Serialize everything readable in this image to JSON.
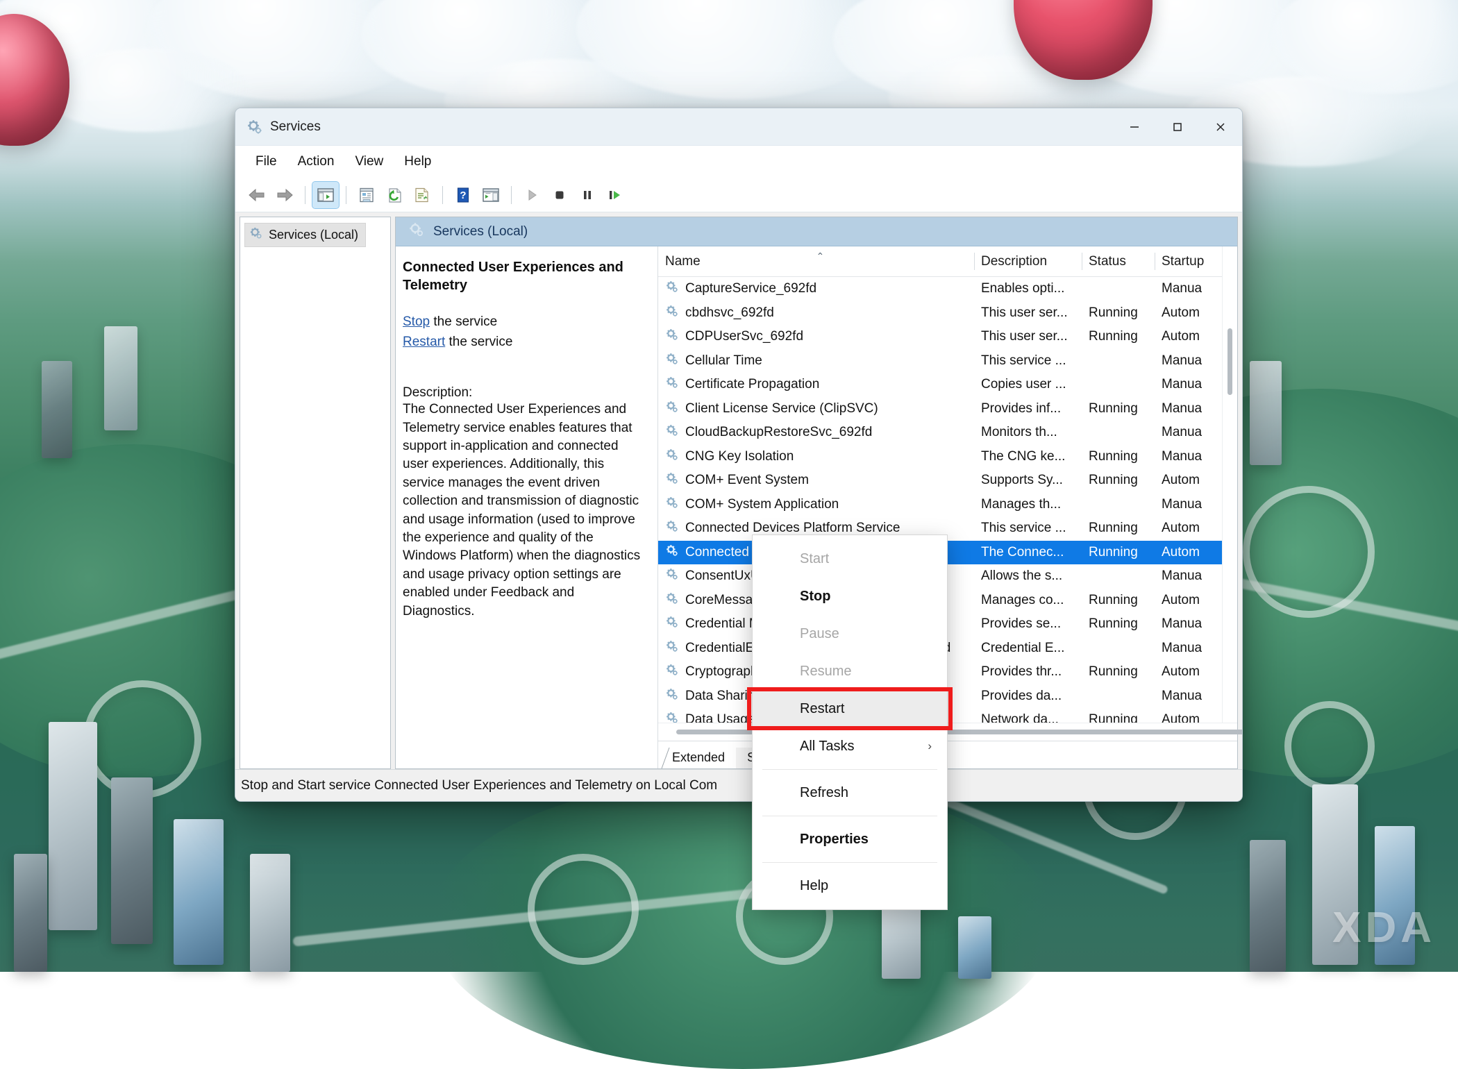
{
  "window": {
    "title": "Services",
    "title_icon": "services-gear-icon",
    "controls": {
      "minimize": "—",
      "maximize": "☐",
      "close": "✕"
    }
  },
  "menubar": [
    {
      "label": "File",
      "name": "menu-file"
    },
    {
      "label": "Action",
      "name": "menu-action"
    },
    {
      "label": "View",
      "name": "menu-view"
    },
    {
      "label": "Help",
      "name": "menu-help"
    }
  ],
  "toolbar": [
    {
      "name": "back-icon"
    },
    {
      "name": "forward-icon"
    },
    {
      "name": "show-hide-console-tree-icon"
    },
    {
      "name": "properties-icon"
    },
    {
      "name": "refresh-icon"
    },
    {
      "name": "export-list-icon"
    },
    {
      "name": "help-icon"
    },
    {
      "name": "show-hide-action-pane-icon"
    },
    {
      "name": "start-service-icon"
    },
    {
      "name": "stop-service-icon"
    },
    {
      "name": "pause-service-icon"
    },
    {
      "name": "restart-service-icon"
    }
  ],
  "tree": {
    "root_label": "Services (Local)"
  },
  "right_pane": {
    "header": "Services (Local)"
  },
  "detail": {
    "service_name": "Connected User Experiences and Telemetry",
    "stop_link": "Stop",
    "stop_suffix": " the service",
    "restart_link": "Restart",
    "restart_suffix": " the service",
    "description_label": "Description:",
    "description_body": "The Connected User Experiences and Telemetry service enables features that support in-application and connected user experiences. Additionally, this service manages the event driven collection and transmission of diagnostic and usage information (used to improve the experience and quality of the Windows Platform) when the diagnostics and usage privacy option settings are enabled under Feedback and Diagnostics."
  },
  "list": {
    "columns": [
      "Name",
      "Description",
      "Status",
      "Startup"
    ],
    "sort_indicator": "⌃",
    "rows": [
      {
        "name": "CaptureService_692fd",
        "desc": "Enables opti...",
        "status": "",
        "startup": "Manua"
      },
      {
        "name": "cbdhsvc_692fd",
        "desc": "This user ser...",
        "status": "Running",
        "startup": "Autom"
      },
      {
        "name": "CDPUserSvc_692fd",
        "desc": "This user ser...",
        "status": "Running",
        "startup": "Autom"
      },
      {
        "name": "Cellular Time",
        "desc": "This service ...",
        "status": "",
        "startup": "Manua"
      },
      {
        "name": "Certificate Propagation",
        "desc": "Copies user ...",
        "status": "",
        "startup": "Manua"
      },
      {
        "name": "Client License Service (ClipSVC)",
        "desc": "Provides inf...",
        "status": "Running",
        "startup": "Manua"
      },
      {
        "name": "CloudBackupRestoreSvc_692fd",
        "desc": "Monitors th...",
        "status": "",
        "startup": "Manua"
      },
      {
        "name": "CNG Key Isolation",
        "desc": "The CNG ke...",
        "status": "Running",
        "startup": "Manua"
      },
      {
        "name": "COM+ Event System",
        "desc": "Supports Sy...",
        "status": "Running",
        "startup": "Autom"
      },
      {
        "name": "COM+ System Application",
        "desc": "Manages th...",
        "status": "",
        "startup": "Manua"
      },
      {
        "name": "Connected Devices Platform Service",
        "desc": "This service ...",
        "status": "Running",
        "startup": "Autom"
      },
      {
        "name": "Connected User Experiences and Telemetry",
        "desc": "The Connec...",
        "status": "Running",
        "startup": "Autom",
        "selected": true
      },
      {
        "name": "ConsentUxUserSvc_692fd",
        "desc": "Allows the s...",
        "status": "",
        "startup": "Manua"
      },
      {
        "name": "CoreMessaging",
        "desc": "Manages co...",
        "status": "Running",
        "startup": "Autom"
      },
      {
        "name": "Credential Manager",
        "desc": "Provides se...",
        "status": "Running",
        "startup": "Manua"
      },
      {
        "name": "CredentialEnrollmentManagerUserSvc_692fd",
        "desc": "Credential E...",
        "status": "",
        "startup": "Manua"
      },
      {
        "name": "Cryptographic Services",
        "desc": "Provides thr...",
        "status": "Running",
        "startup": "Autom"
      },
      {
        "name": "Data Sharing Service",
        "desc": "Provides da...",
        "status": "",
        "startup": "Manua"
      },
      {
        "name": "Data Usage",
        "desc": "Network da...",
        "status": "Running",
        "startup": "Autom"
      }
    ]
  },
  "tabs": [
    {
      "label": "Extended",
      "active": false
    },
    {
      "label": "Standard",
      "active": true
    }
  ],
  "statusbar": {
    "text": "Stop and Start service Connected User Experiences and Telemetry on Local Com"
  },
  "context_menu": {
    "items": [
      {
        "label": "Start",
        "state": "disabled",
        "name": "ctx-start"
      },
      {
        "label": "Stop",
        "state": "bold",
        "name": "ctx-stop"
      },
      {
        "label": "Pause",
        "state": "disabled",
        "name": "ctx-pause"
      },
      {
        "label": "Resume",
        "state": "disabled",
        "name": "ctx-resume"
      },
      {
        "label": "Restart",
        "state": "highlight",
        "name": "ctx-restart"
      },
      {
        "label": "All Tasks",
        "state": "submenu",
        "name": "ctx-all-tasks",
        "chevron": "›"
      },
      {
        "label": "Refresh",
        "state": "normal",
        "name": "ctx-refresh"
      },
      {
        "label": "Properties",
        "state": "bold",
        "name": "ctx-properties"
      },
      {
        "label": "Help",
        "state": "normal",
        "name": "ctx-help"
      }
    ]
  },
  "annotation": {
    "target": "Restart",
    "color": "#ef1c1c"
  },
  "desktop": {
    "watermark": "XDA"
  },
  "colors": {
    "selection_blue": "#0f7ae5",
    "link_blue": "#2559a8",
    "titlebar": "#eaf1f6",
    "pane_header": "#b6cfe3",
    "annotation_red": "#ef1c1c"
  }
}
